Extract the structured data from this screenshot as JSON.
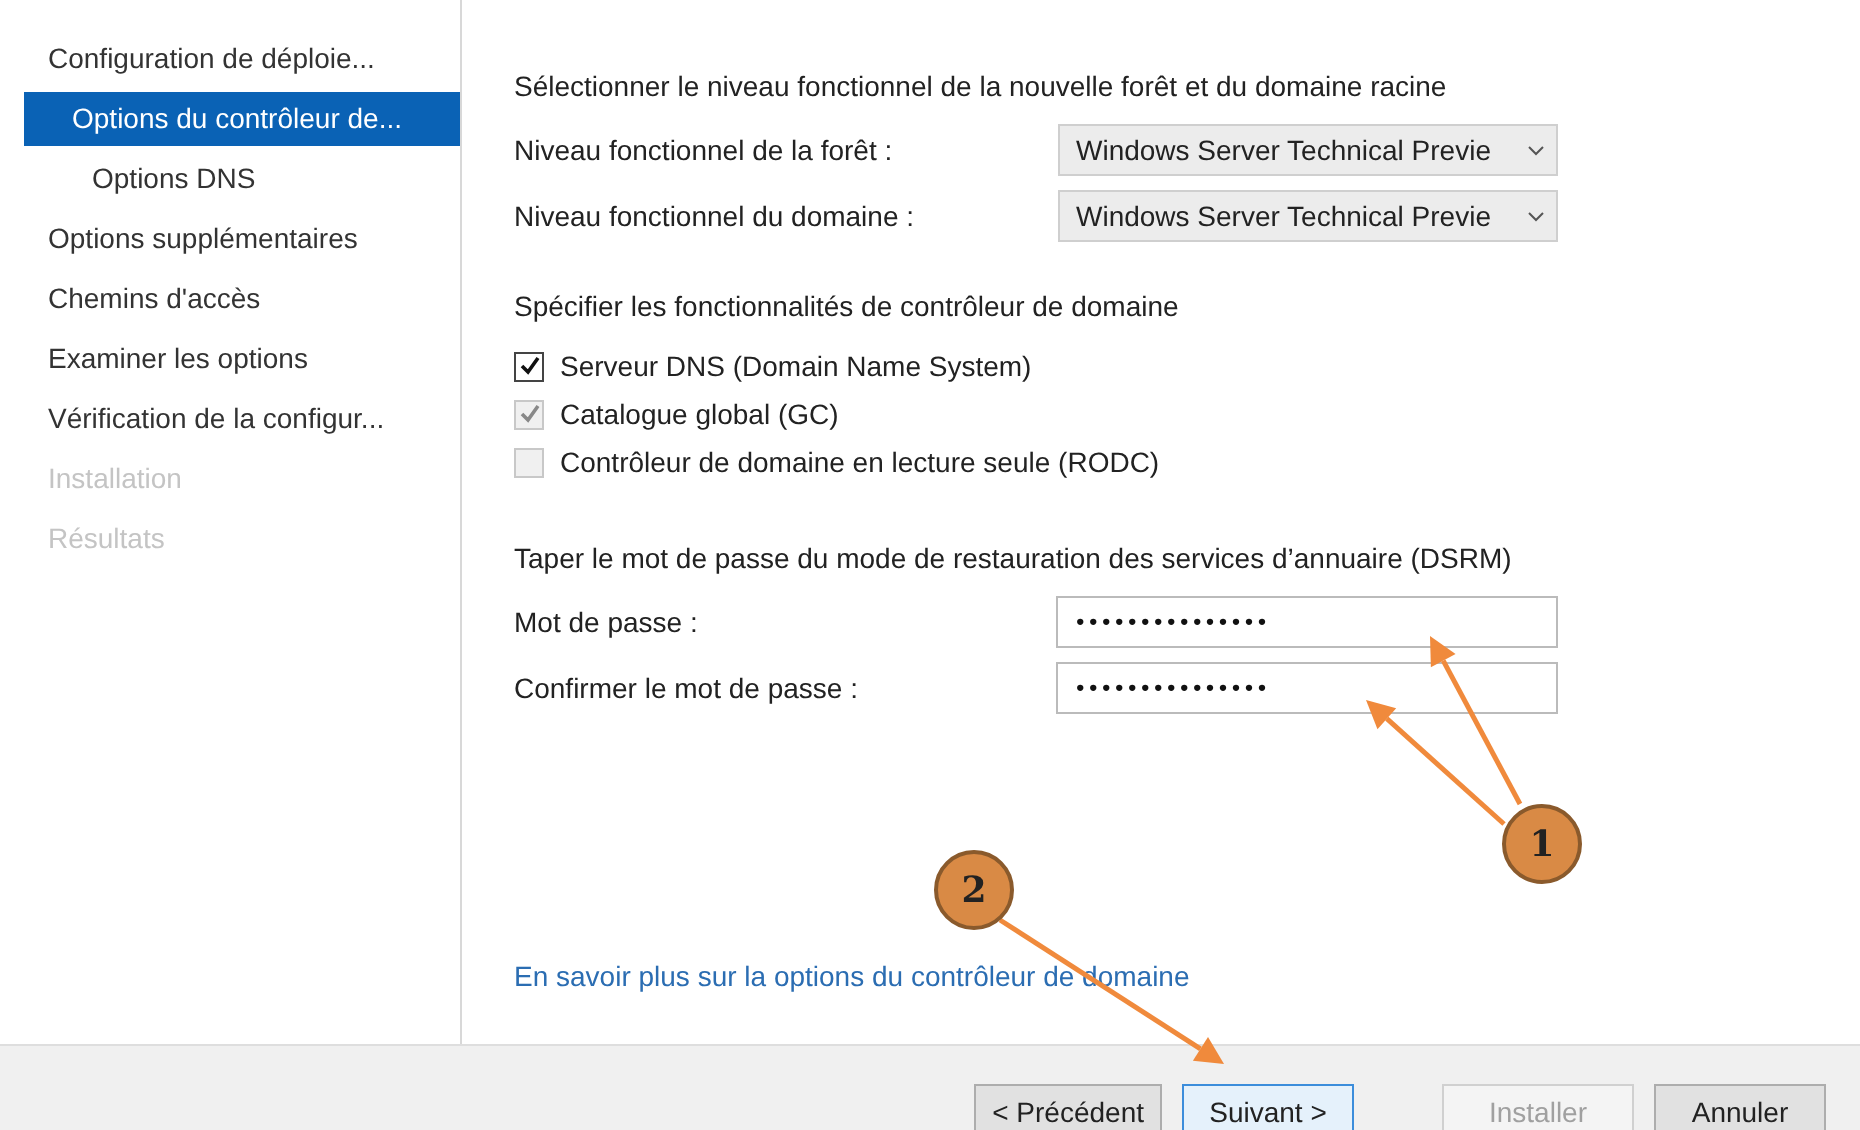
{
  "sidebar": {
    "items": [
      {
        "label": "Configuration de déploie...",
        "selected": false,
        "disabled": false
      },
      {
        "label": "Options du contrôleur de...",
        "selected": true,
        "disabled": false,
        "children": [
          {
            "label": "Options DNS",
            "selected": false,
            "disabled": false
          }
        ]
      },
      {
        "label": "Options supplémentaires",
        "selected": false,
        "disabled": false
      },
      {
        "label": "Chemins d'accès",
        "selected": false,
        "disabled": false
      },
      {
        "label": "Examiner les options",
        "selected": false,
        "disabled": false
      },
      {
        "label": "Vérification de la configur...",
        "selected": false,
        "disabled": false
      },
      {
        "label": "Installation",
        "selected": false,
        "disabled": true
      },
      {
        "label": "Résultats",
        "selected": false,
        "disabled": true
      }
    ]
  },
  "functional_level": {
    "heading": "Sélectionner le niveau fonctionnel de la nouvelle forêt et du domaine racine",
    "fields": [
      {
        "label": "Niveau fonctionnel de la forêt :",
        "value": "Windows Server Technical Previe"
      },
      {
        "label": "Niveau fonctionnel du domaine :",
        "value": "Windows Server Technical Previe"
      }
    ]
  },
  "capabilities": {
    "heading": "Spécifier les fonctionnalités de contrôleur de domaine",
    "options": [
      {
        "label": "Serveur DNS (Domain Name System)",
        "checked": true,
        "disabled": false
      },
      {
        "label": "Catalogue global (GC)",
        "checked": true,
        "disabled": true
      },
      {
        "label": "Contrôleur de domaine en lecture seule (RODC)",
        "checked": false,
        "disabled": true
      }
    ]
  },
  "dsrm": {
    "heading": "Taper le mot de passe du mode de restauration des services d’annuaire (DSRM)",
    "fields": [
      {
        "label": "Mot de passe :",
        "value": "•••••••••••••••"
      },
      {
        "label": "Confirmer le mot de passe :",
        "value": "•••••••••••••••"
      }
    ]
  },
  "help_link": "En savoir plus sur la options du contrôleur de domaine",
  "buttons": [
    {
      "label": "< Précédent",
      "disabled": false,
      "focused": false
    },
    {
      "label": "Suivant >",
      "disabled": false,
      "focused": true
    },
    {
      "label": "Installer",
      "disabled": true,
      "focused": false
    },
    {
      "label": "Annuler",
      "disabled": false,
      "focused": false
    }
  ],
  "annotations": [
    {
      "label": "1"
    },
    {
      "label": "2"
    }
  ]
}
